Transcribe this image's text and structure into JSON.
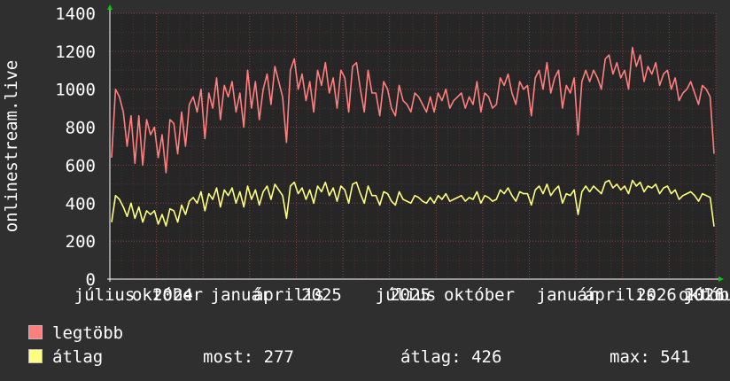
{
  "chart_data": {
    "type": "line",
    "ylabel": "onlinestream.live",
    "ylim": [
      0,
      1400
    ],
    "yticks": [
      0,
      200,
      400,
      600,
      800,
      1000,
      1200,
      1400
    ],
    "xtick_labels": [
      "július",
      "október",
      "2024",
      "január",
      "április",
      "2025",
      "július",
      "október",
      "2025",
      "január",
      "április",
      "2026",
      "július",
      "október",
      "2026"
    ],
    "grid": true,
    "series": [
      {
        "name": "legtöbb",
        "color": "#ff7f7f",
        "values": [
          640,
          1000,
          960,
          880,
          700,
          860,
          610,
          860,
          600,
          840,
          760,
          800,
          640,
          760,
          560,
          840,
          820,
          660,
          880,
          700,
          920,
          960,
          880,
          1000,
          740,
          980,
          900,
          1060,
          840,
          1020,
          960,
          1040,
          880,
          980,
          800,
          1100,
          900,
          1040,
          840,
          1000,
          1080,
          920,
          1120,
          1040,
          960,
          720,
          1100,
          1160,
          1000,
          1080,
          940,
          1040,
          880,
          1100,
          1020,
          1140,
          980,
          1060,
          900,
          1100,
          1060,
          880,
          1120,
          1140,
          1000,
          880,
          1100,
          980,
          980,
          860,
          1040,
          1000,
          900,
          860,
          1020,
          940,
          920,
          880,
          980,
          960,
          920,
          880,
          960,
          880,
          980,
          940,
          1000,
          900,
          940,
          960,
          980,
          900,
          960,
          920,
          1040,
          880,
          980,
          960,
          900,
          920,
          1060,
          1020,
          1080,
          980,
          920,
          1040,
          1000,
          1020,
          860,
          1060,
          1100,
          1000,
          1140,
          980,
          1060,
          1100,
          900,
          1020,
          980,
          1060,
          760,
          1040,
          1100,
          1040,
          1100,
          1060,
          1000,
          1160,
          1180,
          1080,
          1140,
          1060,
          1100,
          1000,
          1220,
          1120,
          1180,
          1040,
          1120,
          1080,
          1140,
          1020,
          1080,
          1100,
          1000,
          1060,
          940,
          980,
          1000,
          1040,
          980,
          920,
          1020,
          1000,
          960,
          660
        ],
        "min": 520,
        "max": 1270
      },
      {
        "name": "átlag",
        "color": "#ffff7f",
        "values": [
          300,
          440,
          420,
          380,
          330,
          400,
          320,
          380,
          300,
          360,
          340,
          360,
          290,
          340,
          280,
          370,
          360,
          300,
          390,
          340,
          410,
          430,
          400,
          460,
          360,
          450,
          420,
          480,
          380,
          470,
          440,
          480,
          400,
          460,
          380,
          490,
          420,
          470,
          390,
          460,
          490,
          420,
          500,
          470,
          440,
          320,
          490,
          510,
          450,
          480,
          420,
          470,
          400,
          490,
          460,
          510,
          440,
          480,
          410,
          490,
          470,
          400,
          500,
          510,
          450,
          400,
          490,
          440,
          440,
          390,
          460,
          450,
          410,
          390,
          460,
          420,
          410,
          400,
          440,
          430,
          410,
          400,
          430,
          400,
          440,
          420,
          450,
          410,
          420,
          430,
          440,
          410,
          430,
          420,
          460,
          400,
          440,
          430,
          410,
          420,
          470,
          450,
          480,
          440,
          410,
          460,
          450,
          450,
          390,
          470,
          490,
          450,
          500,
          440,
          470,
          490,
          400,
          450,
          440,
          470,
          340,
          460,
          490,
          460,
          490,
          470,
          450,
          510,
          520,
          480,
          500,
          470,
          490,
          450,
          520,
          490,
          510,
          460,
          490,
          480,
          500,
          450,
          480,
          490,
          450,
          470,
          420,
          440,
          450,
          460,
          440,
          410,
          450,
          440,
          430,
          277
        ],
        "min": 260,
        "max": 541
      }
    ]
  },
  "legend": {
    "items": [
      {
        "label": "legtöbb",
        "color": "#ff7f7f"
      },
      {
        "label": "átlag",
        "color": "#ffff7f"
      }
    ],
    "stats": {
      "most": "most: 277",
      "atlag": "átlag: 426",
      "max": "max: 541"
    }
  },
  "colors": {
    "background": "#2f2f2f",
    "plot_background": "#262626",
    "grid": "#7a3a3a",
    "text": "#ffffff"
  }
}
